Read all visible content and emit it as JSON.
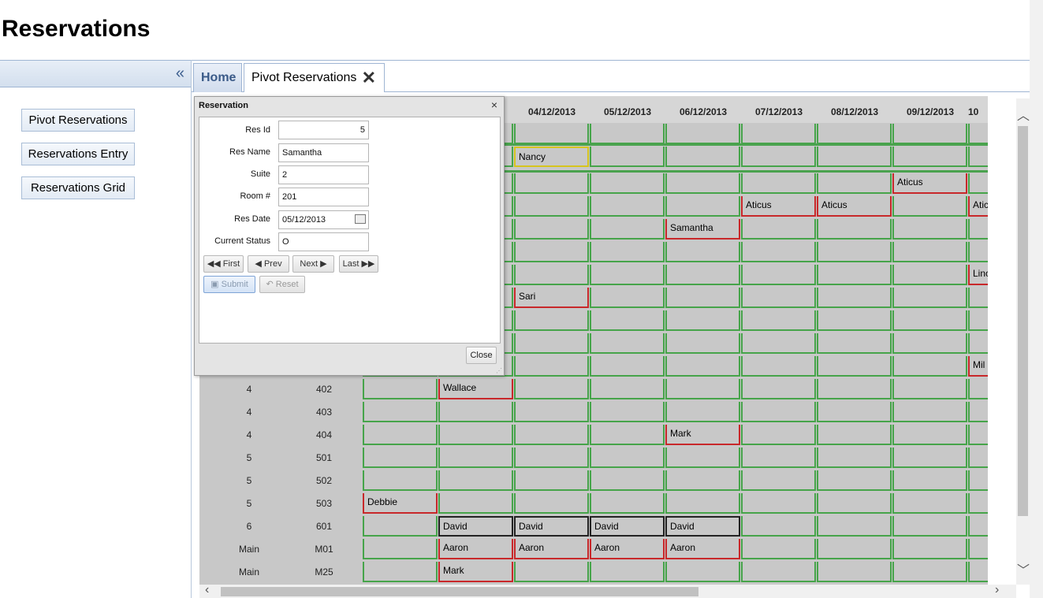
{
  "app_title": "Reservations",
  "sidebar": {
    "collapse_icon": "«",
    "items": [
      {
        "label": "Pivot Reservations"
      },
      {
        "label": "Reservations Entry"
      },
      {
        "label": "Reservations Grid"
      }
    ]
  },
  "tabs": [
    {
      "label": "Home"
    },
    {
      "label": "Pivot Reservations",
      "close_icon": "✕"
    }
  ],
  "grid": {
    "dates": [
      "04/12/2013",
      "05/12/2013",
      "06/12/2013",
      "07/12/2013",
      "08/12/2013",
      "09/12/2013",
      "10"
    ],
    "visible_rows": [
      {
        "suite": "4",
        "room": "402"
      },
      {
        "suite": "4",
        "room": "403"
      },
      {
        "suite": "4",
        "room": "404"
      },
      {
        "suite": "5",
        "room": "501"
      },
      {
        "suite": "5",
        "room": "502"
      },
      {
        "suite": "5",
        "room": "503"
      },
      {
        "suite": "6",
        "room": "601"
      },
      {
        "suite": "Main",
        "room": "M01"
      },
      {
        "suite": "Main",
        "room": "M25"
      }
    ],
    "names": {
      "nancy": "Nancy",
      "aticus": "Aticus",
      "samantha": "Samantha",
      "lin": "Linc",
      "sari": "Sari",
      "mil": "Mil",
      "wallace": "Wallace",
      "mark": "Mark",
      "debbie": "Debbie",
      "david": "David",
      "aaron": "Aaron"
    }
  },
  "dialog": {
    "title": "Reservation",
    "close_x": "×",
    "fields": [
      {
        "label": "Res Id",
        "value": "5"
      },
      {
        "label": "Res Name",
        "value": "Samantha"
      },
      {
        "label": "Suite",
        "value": "2"
      },
      {
        "label": "Room #",
        "value": "201"
      },
      {
        "label": "Res Date",
        "value": "05/12/2013"
      },
      {
        "label": "Current Status",
        "value": "O"
      }
    ],
    "nav": {
      "first": "First",
      "prev": "Prev",
      "next": "Next",
      "last": "Last"
    },
    "submit": "Submit",
    "reset": "Reset",
    "close": "Close"
  },
  "colors": {
    "booked_border": "#c8282a",
    "free_border": "#46a44a",
    "selected_border": "#d6c41e"
  }
}
